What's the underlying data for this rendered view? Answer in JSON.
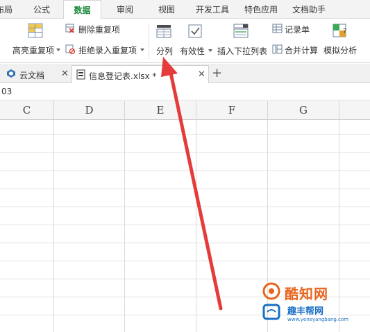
{
  "menu_tabs": [
    {
      "label": "布局"
    },
    {
      "label": "公式"
    },
    {
      "label": "数据"
    },
    {
      "label": "审阅"
    },
    {
      "label": "视图"
    },
    {
      "label": "开发工具"
    },
    {
      "label": "特色应用"
    },
    {
      "label": "文档助手"
    }
  ],
  "ribbon": {
    "highlight_dup": "高亮重复项",
    "delete_dup": "删除重复项",
    "reject_dup": "拒绝录入重复项",
    "split_column": "分列",
    "validity": "有效性",
    "insert_dropdown": "插入下拉列表",
    "record_sheet": "记录单",
    "consolidate": "合并计算",
    "simulate": "模拟分析"
  },
  "doc_tabs": [
    {
      "label": "云文档"
    },
    {
      "label": "信息登记表.xlsx *"
    }
  ],
  "formula_bar": {
    "cell_ref": "03"
  },
  "columns": [
    "C",
    "D",
    "E",
    "F",
    "G"
  ],
  "watermark": {
    "line1": "酷知网",
    "line2": "趣丰帮网",
    "line3": "www.yeneyangbang.com"
  },
  "colors": {
    "active_tab": "#1a8a3a",
    "arrow": "#e53b3b",
    "watermark_orange": "#e9641e",
    "watermark_blue": "#1a6fc4"
  }
}
